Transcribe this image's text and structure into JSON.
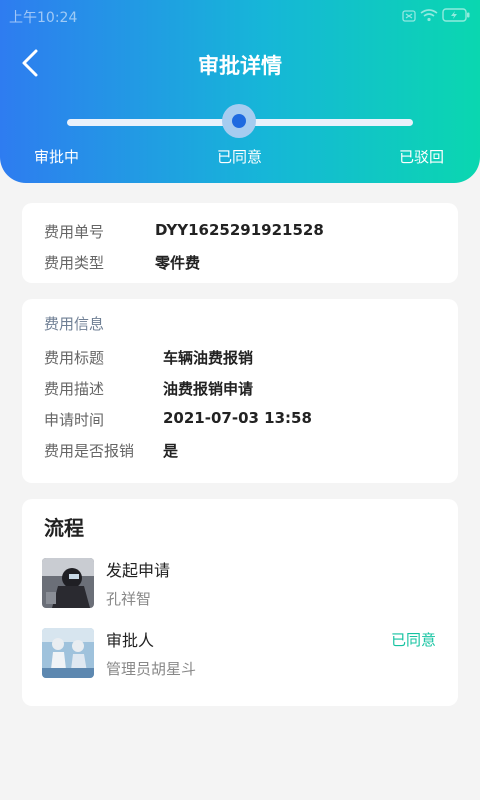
{
  "status_bar": {
    "time": "上午10:24",
    "icons": [
      "sim-icon",
      "wifi-icon",
      "battery-icon"
    ]
  },
  "header": {
    "title": "审批详情",
    "progress": {
      "steps": [
        "审批中",
        "已同意",
        "已驳回"
      ],
      "current_index": 1,
      "current_label": "已同意"
    }
  },
  "basic_info": {
    "fee_no_label": "费用单号",
    "fee_no_value": "DYY1625291921528",
    "fee_type_label": "费用类型",
    "fee_type_value": "零件费"
  },
  "fee_info": {
    "section_title": "费用信息",
    "title_label": "费用标题",
    "title_value": "车辆油费报销",
    "desc_label": "费用描述",
    "desc_value": "油费报销申请",
    "time_label": "申请时间",
    "time_value": "2021-07-03 13:58",
    "reimburse_label": "费用是否报销",
    "reimburse_value": "是"
  },
  "process": {
    "title": "流程",
    "items": [
      {
        "name": "发起申请",
        "person": "孔祥智",
        "status": ""
      },
      {
        "name": "审批人",
        "person": "管理员胡星斗",
        "status": "已同意"
      }
    ]
  },
  "colors": {
    "gradient_start": "#2e7cf0",
    "gradient_end": "#0ad7b0",
    "accent_green": "#15c3a1",
    "thumb_blue": "#1e6ae0"
  }
}
